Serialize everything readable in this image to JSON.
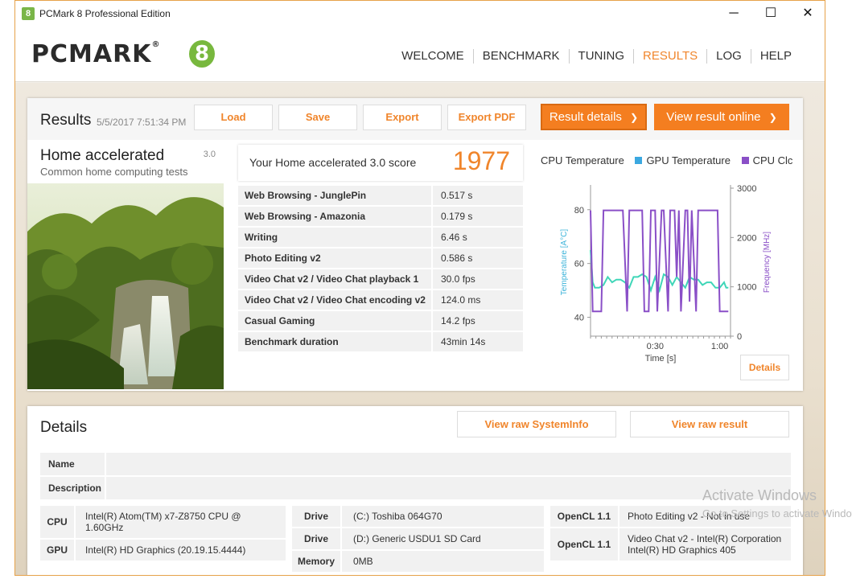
{
  "window": {
    "title": "PCMark 8 Professional Edition",
    "app_icon": "pcmark-8-icon",
    "controls": {
      "minimize": "─",
      "maximize": "☐",
      "close": "✕"
    }
  },
  "header": {
    "logo_text": "PCMARK",
    "logo_reg": "®",
    "logo_mark": "8",
    "nav": [
      "WELCOME",
      "BENCHMARK",
      "TUNING",
      "RESULTS",
      "LOG",
      "HELP"
    ],
    "active_nav": "RESULTS"
  },
  "results": {
    "title": "Results",
    "date": "5/5/2017 7:51:34 PM",
    "buttons": {
      "load": "Load",
      "save": "Save",
      "export": "Export",
      "export_pdf": "Export PDF"
    },
    "result_details": "Result details",
    "view_online": "View result online",
    "chevron": "❯",
    "test": {
      "name": "Home accelerated",
      "version": "3.0",
      "description": "Common home computing tests"
    },
    "score_label": "Your Home accelerated 3.0 score",
    "score": "1977",
    "rows": [
      {
        "name": "Web Browsing - JunglePin",
        "value": "0.517 s"
      },
      {
        "name": "Web Browsing - Amazonia",
        "value": "0.179 s"
      },
      {
        "name": "Writing",
        "value": "6.46 s"
      },
      {
        "name": "Photo Editing v2",
        "value": "0.586 s"
      },
      {
        "name": "Video Chat v2 / Video Chat playback 1 v2",
        "value": "30.0 fps"
      },
      {
        "name": "Video Chat v2 / Video Chat encoding v2",
        "value": "124.0 ms"
      },
      {
        "name": "Casual Gaming",
        "value": "14.2 fps"
      },
      {
        "name": "Benchmark duration",
        "value": "43min 14s"
      }
    ],
    "details_button": "Details"
  },
  "chart_data": {
    "type": "line",
    "legend": [
      "CPU Temperature",
      "GPU Temperature",
      "CPU Clc"
    ],
    "colors": {
      "cpu_temp": "#3fd6b8",
      "gpu_temp": "#3ba8e0",
      "cpu_clock": "#8a4fc7"
    },
    "xlabel": "Time [s]",
    "ylabel_left": "Temperature [A°C]",
    "ylabel_right": "Frequency [MHz]",
    "xticks": [
      "0:30",
      "1:00"
    ],
    "xlim": [
      0,
      65
    ],
    "yticks_left": [
      40,
      60,
      80
    ],
    "ylim_left": [
      33,
      88
    ],
    "yticks_right": [
      0,
      1000,
      2000,
      3000
    ],
    "ylim_right": [
      0,
      3000
    ],
    "series": [
      {
        "name": "CPU Temperature",
        "axis": "left",
        "x": [
          0,
          1,
          2,
          4,
          6,
          8,
          10,
          12,
          14,
          16,
          18,
          20,
          22,
          24,
          26,
          28,
          30,
          32,
          34,
          36,
          38,
          40,
          42,
          44,
          46,
          48,
          50,
          52,
          54,
          56,
          58,
          60,
          62,
          63,
          64
        ],
        "y": [
          65,
          53,
          51,
          51,
          52,
          55,
          53,
          54,
          54,
          53,
          51,
          55,
          55,
          56,
          55,
          50,
          55,
          50,
          56,
          55,
          52,
          55,
          53,
          51,
          55,
          54,
          54,
          52,
          53,
          53,
          51,
          51,
          53,
          51,
          51
        ]
      },
      {
        "name": "CPU Clock",
        "axis": "right",
        "x": [
          0,
          1,
          3,
          5,
          6,
          14,
          15,
          17,
          18,
          24,
          25,
          27,
          28,
          30,
          31,
          33,
          34,
          36,
          37,
          39,
          40,
          41,
          42,
          44,
          45,
          46,
          47,
          49,
          50,
          51,
          52,
          59,
          60,
          61,
          62,
          64
        ],
        "y": [
          2550,
          500,
          500,
          500,
          2550,
          2550,
          2550,
          500,
          2550,
          2550,
          500,
          500,
          2550,
          2550,
          500,
          2550,
          2550,
          500,
          2550,
          2550,
          1200,
          2550,
          500,
          2550,
          2550,
          700,
          2550,
          500,
          2550,
          2550,
          2550,
          2550,
          500,
          500,
          500,
          500
        ]
      }
    ]
  },
  "details": {
    "title": "Details",
    "view_raw_sysinfo": "View raw SystemInfo",
    "view_raw_result": "View raw result",
    "name_label": "Name",
    "description_label": "Description",
    "name_value": "",
    "description_value": "",
    "hardware": {
      "cpu_label": "CPU",
      "cpu_value": "Intel(R) Atom(TM) x7-Z8750  CPU @ 1.60GHz",
      "gpu_label": "GPU",
      "gpu_value": "Intel(R) HD Graphics (20.19.15.4444)",
      "drive1_label": "Drive",
      "drive1_value": "(C:) Toshiba 064G70",
      "drive2_label": "Drive",
      "drive2_value": "(D:) Generic USDU1 SD Card",
      "memory_label": "Memory",
      "memory_value": "0MB",
      "opencl1_label": "OpenCL 1.1",
      "opencl1_value": "Photo Editing v2 - Not in use",
      "opencl2_label": "OpenCL 1.1",
      "opencl2_value": "Video Chat v2 - Intel(R) Corporation Intel(R) HD Graphics 405"
    }
  },
  "watermark": {
    "line1": "Activate Windows",
    "line2": "Go to Settings to activate Windows."
  }
}
